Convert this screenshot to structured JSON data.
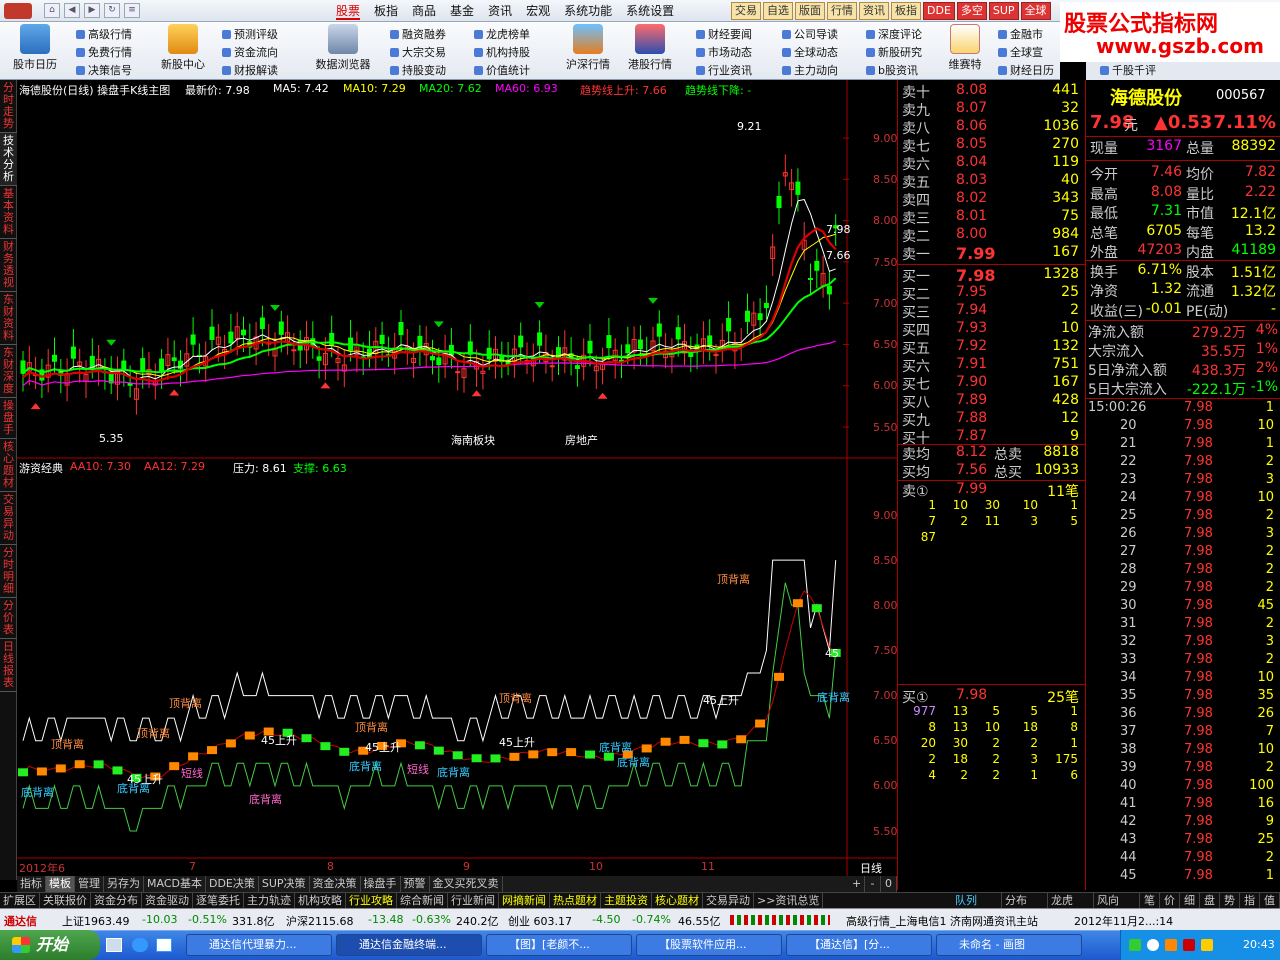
{
  "menu": {
    "tabs": [
      "股票",
      "板指",
      "商品",
      "基金",
      "资讯",
      "宏观",
      "系统功能",
      "系统设置"
    ],
    "active": 0,
    "quick": [
      "交易",
      "自选",
      "版面",
      "行情",
      "资讯",
      "板指",
      "DDE",
      "多空",
      "SUP",
      "全球"
    ]
  },
  "brand": {
    "line1": "股票公式指标网",
    "line2": "www.gszb.com"
  },
  "toolbar": {
    "big": [
      "股市日历",
      "新股中心",
      "数据浏览器",
      "沪深行情",
      "港股行情",
      "维赛特"
    ],
    "col1": [
      "高级行情",
      "免费行情",
      "决策信号"
    ],
    "col2": [
      "预测评级",
      "资金流向",
      "财报解读"
    ],
    "col3": [
      "融资融券",
      "大宗交易",
      "持股变动"
    ],
    "col4": [
      "龙虎榜单",
      "机构持股",
      "价值统计"
    ],
    "col5": [
      "财经要闻",
      "市场动态",
      "行业资讯"
    ],
    "col6": [
      "公司导读",
      "全球动态",
      "主力动向"
    ],
    "col7": [
      "深度评论",
      "新股研究",
      "b股资讯"
    ],
    "col8": [
      "金融市",
      "全球宣",
      "财经日历"
    ],
    "col9": [
      "千股千评"
    ]
  },
  "lefttabs": [
    "分时走势",
    "技术分析",
    "基本资料",
    "财务透视",
    "东财资料",
    "东财深度",
    "操盘手",
    "核心题材",
    "交易异动",
    "分时明细",
    "分价表",
    "日线报表"
  ],
  "chart": {
    "main_title": "海德股份(日线) 操盘手K线主图",
    "latest_label": "最新价: 7.98",
    "ma5": "MA5: 7.42",
    "ma10": "MA10: 7.29",
    "ma20": "MA20: 7.62",
    "ma60": "MA60: 6.93",
    "trend_up": "趋势线上升: 7.66",
    "trend_down": "趋势线下降: -",
    "high_mark": "9.21",
    "low_mark": "5.35",
    "price_r1": "7.98",
    "price_r2": "7.66",
    "note1": "海南板块",
    "note2": "房地产",
    "y_main": [
      "9.00",
      "8.50",
      "8.00",
      "7.50",
      "7.00",
      "6.50",
      "6.00",
      "5.50"
    ],
    "sub_title": "游资经典",
    "aa10": "AA10: 7.30",
    "aa12": "AA12: 7.29",
    "pressure": "压力: 8.61",
    "support": "支撑: 6.63",
    "y_sub": [
      "9.00",
      "8.50",
      "8.00",
      "7.50",
      "7.00",
      "6.50",
      "6.00",
      "5.50"
    ],
    "xaxis": [
      "2012年6",
      "7",
      "8",
      "9",
      "10",
      "11"
    ],
    "period": "日线",
    "labels": [
      "顶背离",
      "顶背离",
      "顶背离",
      "顶背离",
      "顶背离",
      "顶背离",
      "45上升",
      "45上升",
      "45上升",
      "45上升",
      "45上升",
      "45",
      "底背离",
      "底背离",
      "底背离",
      "底背离",
      "底背离",
      "底背离",
      "底背离",
      "短线",
      "短线",
      "底背离"
    ]
  },
  "orderbook": {
    "sells": [
      [
        "卖十",
        "8.08",
        "441"
      ],
      [
        "卖九",
        "8.07",
        "32"
      ],
      [
        "卖八",
        "8.06",
        "1036"
      ],
      [
        "卖七",
        "8.05",
        "270"
      ],
      [
        "卖六",
        "8.04",
        "119"
      ],
      [
        "卖五",
        "8.03",
        "40"
      ],
      [
        "卖四",
        "8.02",
        "343"
      ],
      [
        "卖三",
        "8.01",
        "75"
      ],
      [
        "卖二",
        "8.00",
        "984"
      ],
      [
        "卖一",
        "7.99",
        "167"
      ]
    ],
    "buys": [
      [
        "买一",
        "7.98",
        "1328"
      ],
      [
        "买二",
        "7.95",
        "25"
      ],
      [
        "买三",
        "7.94",
        "2"
      ],
      [
        "买四",
        "7.93",
        "10"
      ],
      [
        "买五",
        "7.92",
        "132"
      ],
      [
        "买六",
        "7.91",
        "751"
      ],
      [
        "买七",
        "7.90",
        "167"
      ],
      [
        "买八",
        "7.89",
        "428"
      ],
      [
        "买九",
        "7.88",
        "12"
      ],
      [
        "买十",
        "7.87",
        "9"
      ]
    ],
    "avg_sell": [
      "卖均",
      "8.12",
      "总卖",
      "8818"
    ],
    "avg_buy": [
      "买均",
      "7.56",
      "总买",
      "10933"
    ],
    "sell1_head": [
      "卖①",
      "7.99",
      "11笔"
    ],
    "sell1_grid": [
      [
        "1",
        "10",
        "30",
        "10",
        "1"
      ],
      [
        "7",
        "2",
        "11",
        "3",
        "5"
      ],
      [
        "87",
        "",
        "",
        "",
        ""
      ]
    ],
    "buy1_head": [
      "买①",
      "7.98",
      "25笔"
    ],
    "buy1_grid": [
      [
        "977",
        "13",
        "5",
        "5",
        "1"
      ],
      [
        "8",
        "13",
        "10",
        "18",
        "8"
      ],
      [
        "20",
        "30",
        "2",
        "2",
        "1"
      ],
      [
        "2",
        "18",
        "2",
        "3",
        "175"
      ],
      [
        "4",
        "2",
        "2",
        "1",
        "6"
      ]
    ]
  },
  "quote": {
    "name": "海德股份",
    "code": "000567",
    "price": "7.98",
    "unit": "元",
    "change": "▲0.53",
    "pct": "7.11%",
    "rows": [
      [
        "现量",
        "3167",
        "总量",
        "88392"
      ],
      [
        "今开",
        "7.46",
        "均价",
        "7.82"
      ],
      [
        "最高",
        "8.08",
        "量比",
        "2.22"
      ],
      [
        "最低",
        "7.31",
        "市值",
        "12.1亿"
      ],
      [
        "总笔",
        "6705",
        "每笔",
        "13.2"
      ],
      [
        "外盘",
        "47203",
        "内盘",
        "41189"
      ],
      [
        "换手",
        "6.71%",
        "股本",
        "1.51亿"
      ],
      [
        "净资",
        "1.32",
        "流通",
        "1.32亿"
      ],
      [
        "收益(三)",
        "-0.01",
        "PE(动)",
        "-"
      ]
    ],
    "flows": [
      [
        "净流入额",
        "279.2万",
        "4%"
      ],
      [
        "大宗流入",
        "35.5万",
        "1%"
      ],
      [
        "5日净流入额",
        "438.3万",
        "2%"
      ],
      [
        "5日大宗流入",
        "-222.1万",
        "-1%"
      ]
    ],
    "ticks": [
      [
        "15:00:26",
        "7.98",
        "1"
      ],
      [
        "20",
        "7.98",
        "10"
      ],
      [
        "21",
        "7.98",
        "1"
      ],
      [
        "22",
        "7.98",
        "2"
      ],
      [
        "23",
        "7.98",
        "3"
      ],
      [
        "24",
        "7.98",
        "10"
      ],
      [
        "25",
        "7.98",
        "2"
      ],
      [
        "26",
        "7.98",
        "3"
      ],
      [
        "27",
        "7.98",
        "2"
      ],
      [
        "28",
        "7.98",
        "2"
      ],
      [
        "29",
        "7.98",
        "2"
      ],
      [
        "30",
        "7.98",
        "45"
      ],
      [
        "31",
        "7.98",
        "2"
      ],
      [
        "32",
        "7.98",
        "3"
      ],
      [
        "33",
        "7.98",
        "2"
      ],
      [
        "34",
        "7.98",
        "10"
      ],
      [
        "35",
        "7.98",
        "35"
      ],
      [
        "36",
        "7.98",
        "26"
      ],
      [
        "37",
        "7.98",
        "7"
      ],
      [
        "38",
        "7.98",
        "10"
      ],
      [
        "39",
        "7.98",
        "2"
      ],
      [
        "40",
        "7.98",
        "100"
      ],
      [
        "41",
        "7.98",
        "16"
      ],
      [
        "42",
        "7.98",
        "9"
      ],
      [
        "43",
        "7.98",
        "25"
      ],
      [
        "44",
        "7.98",
        "2"
      ],
      [
        "45",
        "7.98",
        "1"
      ]
    ]
  },
  "bottom": {
    "tabsA": [
      "指标",
      "模板",
      "管理",
      "另存为",
      "MACD基本",
      "DDE决策",
      "SUP决策",
      "资金决策",
      "操盘手",
      "预警",
      "金叉买死叉卖"
    ],
    "tabsA_right": [
      "+",
      "-",
      "0"
    ],
    "tabsB": [
      "扩展区",
      "关联报价",
      "资金分布",
      "资金驱动",
      "逐笔委托",
      "主力轨迹",
      "机构攻略",
      "行业攻略",
      "综合新闻",
      "行业新闻",
      "网摘新闻",
      "热点题材",
      "主题投资",
      "核心题材",
      "交易异动",
      ">>资讯总览",
      "队列",
      "分布",
      "龙虎",
      "风向",
      "笔",
      "价",
      "细",
      "盘",
      "势",
      "指",
      "值"
    ],
    "ticker": {
      "name": "通达信",
      "sh": "上证1963.49",
      "sh_chg": "-10.03",
      "sh_pct": "-0.51%",
      "sh_amt": "331.8亿",
      "sz": "沪深2115.68",
      "sz_chg": "-13.48",
      "sz_pct": "-0.63%",
      "sz_amt": "240.2亿",
      "cy": "创业 603.17",
      "cy_chg": "-4.50",
      "cy_pct": "-0.74%",
      "cy_amt": "46.55亿",
      "server": "高级行情_上海电信1 济南网通资讯主站",
      "date": "2012年11月2...:14"
    }
  },
  "taskbar": {
    "start": "开始",
    "tasks": [
      "通达信代理暴力...",
      "通达信金融终端...",
      "【图】[老颜不...",
      "【股票软件应用...",
      "【通达信】[分...",
      "未命名 - 画图"
    ],
    "time": "20:43"
  }
}
